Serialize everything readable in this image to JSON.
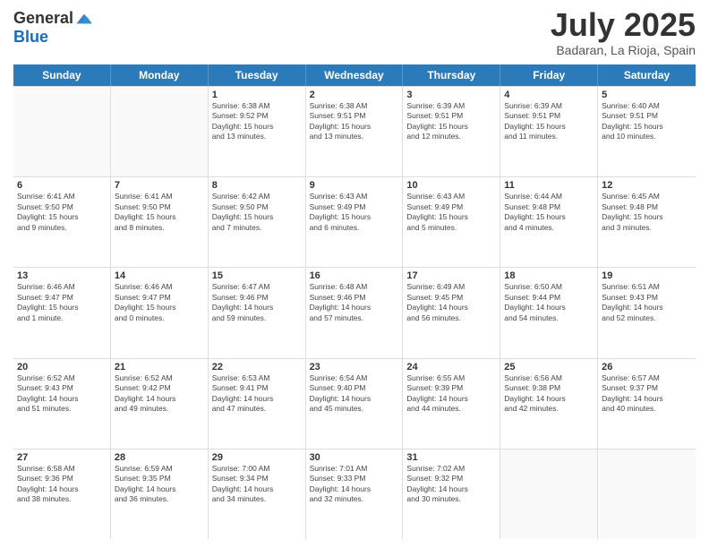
{
  "logo": {
    "general": "General",
    "blue": "Blue"
  },
  "header": {
    "month": "July 2025",
    "location": "Badaran, La Rioja, Spain"
  },
  "weekdays": [
    "Sunday",
    "Monday",
    "Tuesday",
    "Wednesday",
    "Thursday",
    "Friday",
    "Saturday"
  ],
  "weeks": [
    [
      {
        "day": "",
        "empty": true
      },
      {
        "day": "",
        "empty": true
      },
      {
        "day": "1",
        "line1": "Sunrise: 6:38 AM",
        "line2": "Sunset: 9:52 PM",
        "line3": "Daylight: 15 hours",
        "line4": "and 13 minutes."
      },
      {
        "day": "2",
        "line1": "Sunrise: 6:38 AM",
        "line2": "Sunset: 9:51 PM",
        "line3": "Daylight: 15 hours",
        "line4": "and 13 minutes."
      },
      {
        "day": "3",
        "line1": "Sunrise: 6:39 AM",
        "line2": "Sunset: 9:51 PM",
        "line3": "Daylight: 15 hours",
        "line4": "and 12 minutes."
      },
      {
        "day": "4",
        "line1": "Sunrise: 6:39 AM",
        "line2": "Sunset: 9:51 PM",
        "line3": "Daylight: 15 hours",
        "line4": "and 11 minutes."
      },
      {
        "day": "5",
        "line1": "Sunrise: 6:40 AM",
        "line2": "Sunset: 9:51 PM",
        "line3": "Daylight: 15 hours",
        "line4": "and 10 minutes."
      }
    ],
    [
      {
        "day": "6",
        "line1": "Sunrise: 6:41 AM",
        "line2": "Sunset: 9:50 PM",
        "line3": "Daylight: 15 hours",
        "line4": "and 9 minutes."
      },
      {
        "day": "7",
        "line1": "Sunrise: 6:41 AM",
        "line2": "Sunset: 9:50 PM",
        "line3": "Daylight: 15 hours",
        "line4": "and 8 minutes."
      },
      {
        "day": "8",
        "line1": "Sunrise: 6:42 AM",
        "line2": "Sunset: 9:50 PM",
        "line3": "Daylight: 15 hours",
        "line4": "and 7 minutes."
      },
      {
        "day": "9",
        "line1": "Sunrise: 6:43 AM",
        "line2": "Sunset: 9:49 PM",
        "line3": "Daylight: 15 hours",
        "line4": "and 6 minutes."
      },
      {
        "day": "10",
        "line1": "Sunrise: 6:43 AM",
        "line2": "Sunset: 9:49 PM",
        "line3": "Daylight: 15 hours",
        "line4": "and 5 minutes."
      },
      {
        "day": "11",
        "line1": "Sunrise: 6:44 AM",
        "line2": "Sunset: 9:48 PM",
        "line3": "Daylight: 15 hours",
        "line4": "and 4 minutes."
      },
      {
        "day": "12",
        "line1": "Sunrise: 6:45 AM",
        "line2": "Sunset: 9:48 PM",
        "line3": "Daylight: 15 hours",
        "line4": "and 3 minutes."
      }
    ],
    [
      {
        "day": "13",
        "line1": "Sunrise: 6:46 AM",
        "line2": "Sunset: 9:47 PM",
        "line3": "Daylight: 15 hours",
        "line4": "and 1 minute."
      },
      {
        "day": "14",
        "line1": "Sunrise: 6:46 AM",
        "line2": "Sunset: 9:47 PM",
        "line3": "Daylight: 15 hours",
        "line4": "and 0 minutes."
      },
      {
        "day": "15",
        "line1": "Sunrise: 6:47 AM",
        "line2": "Sunset: 9:46 PM",
        "line3": "Daylight: 14 hours",
        "line4": "and 59 minutes."
      },
      {
        "day": "16",
        "line1": "Sunrise: 6:48 AM",
        "line2": "Sunset: 9:46 PM",
        "line3": "Daylight: 14 hours",
        "line4": "and 57 minutes."
      },
      {
        "day": "17",
        "line1": "Sunrise: 6:49 AM",
        "line2": "Sunset: 9:45 PM",
        "line3": "Daylight: 14 hours",
        "line4": "and 56 minutes."
      },
      {
        "day": "18",
        "line1": "Sunrise: 6:50 AM",
        "line2": "Sunset: 9:44 PM",
        "line3": "Daylight: 14 hours",
        "line4": "and 54 minutes."
      },
      {
        "day": "19",
        "line1": "Sunrise: 6:51 AM",
        "line2": "Sunset: 9:43 PM",
        "line3": "Daylight: 14 hours",
        "line4": "and 52 minutes."
      }
    ],
    [
      {
        "day": "20",
        "line1": "Sunrise: 6:52 AM",
        "line2": "Sunset: 9:43 PM",
        "line3": "Daylight: 14 hours",
        "line4": "and 51 minutes."
      },
      {
        "day": "21",
        "line1": "Sunrise: 6:52 AM",
        "line2": "Sunset: 9:42 PM",
        "line3": "Daylight: 14 hours",
        "line4": "and 49 minutes."
      },
      {
        "day": "22",
        "line1": "Sunrise: 6:53 AM",
        "line2": "Sunset: 9:41 PM",
        "line3": "Daylight: 14 hours",
        "line4": "and 47 minutes."
      },
      {
        "day": "23",
        "line1": "Sunrise: 6:54 AM",
        "line2": "Sunset: 9:40 PM",
        "line3": "Daylight: 14 hours",
        "line4": "and 45 minutes."
      },
      {
        "day": "24",
        "line1": "Sunrise: 6:55 AM",
        "line2": "Sunset: 9:39 PM",
        "line3": "Daylight: 14 hours",
        "line4": "and 44 minutes."
      },
      {
        "day": "25",
        "line1": "Sunrise: 6:56 AM",
        "line2": "Sunset: 9:38 PM",
        "line3": "Daylight: 14 hours",
        "line4": "and 42 minutes."
      },
      {
        "day": "26",
        "line1": "Sunrise: 6:57 AM",
        "line2": "Sunset: 9:37 PM",
        "line3": "Daylight: 14 hours",
        "line4": "and 40 minutes."
      }
    ],
    [
      {
        "day": "27",
        "line1": "Sunrise: 6:58 AM",
        "line2": "Sunset: 9:36 PM",
        "line3": "Daylight: 14 hours",
        "line4": "and 38 minutes."
      },
      {
        "day": "28",
        "line1": "Sunrise: 6:59 AM",
        "line2": "Sunset: 9:35 PM",
        "line3": "Daylight: 14 hours",
        "line4": "and 36 minutes."
      },
      {
        "day": "29",
        "line1": "Sunrise: 7:00 AM",
        "line2": "Sunset: 9:34 PM",
        "line3": "Daylight: 14 hours",
        "line4": "and 34 minutes."
      },
      {
        "day": "30",
        "line1": "Sunrise: 7:01 AM",
        "line2": "Sunset: 9:33 PM",
        "line3": "Daylight: 14 hours",
        "line4": "and 32 minutes."
      },
      {
        "day": "31",
        "line1": "Sunrise: 7:02 AM",
        "line2": "Sunset: 9:32 PM",
        "line3": "Daylight: 14 hours",
        "line4": "and 30 minutes."
      },
      {
        "day": "",
        "empty": true
      },
      {
        "day": "",
        "empty": true
      }
    ]
  ]
}
